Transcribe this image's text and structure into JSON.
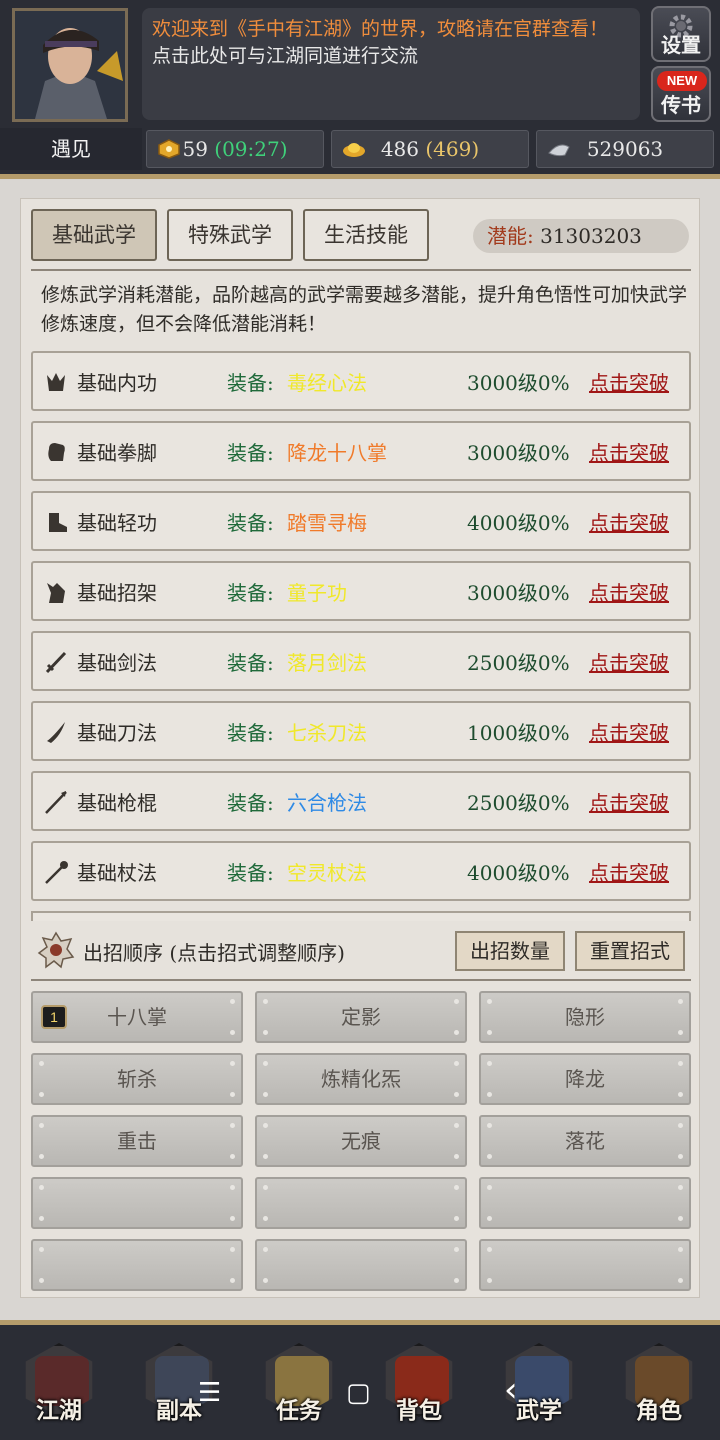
{
  "header": {
    "message_line1": "欢迎来到《手中有江湖》的世界，攻略请在官群查看！",
    "message_line2": "点击此处可与江湖同道进行交流",
    "settings_label": "设置",
    "letter_badge": "NEW",
    "letter_label": "传书",
    "encounter_label": "遇见",
    "resources": [
      {
        "icon": "stamina-icon",
        "value": "59",
        "sub": "(09:27)"
      },
      {
        "icon": "gold-ingot-icon",
        "value": "486",
        "sub": "(469)"
      },
      {
        "icon": "silver-icon",
        "value": "529063",
        "sub": ""
      }
    ]
  },
  "tabs": [
    {
      "label": "基础武学",
      "active": true
    },
    {
      "label": "特殊武学",
      "active": false
    },
    {
      "label": "生活技能",
      "active": false
    }
  ],
  "potential": {
    "label": "潜能:",
    "value": "31303203"
  },
  "description": "修炼武学消耗潜能，品阶越高的武学需要越多潜能，提升角色悟性可加快武学修炼速度，但不会降低潜能消耗！",
  "skills": [
    {
      "name": "基础内功",
      "icon": "inner-power-icon",
      "equip_label": "装备:",
      "equip": "毒经心法",
      "equip_color": "#f0e82a",
      "level": "3000级0%",
      "action": "点击突破"
    },
    {
      "name": "基础拳脚",
      "icon": "fist-icon",
      "equip_label": "装备:",
      "equip": "降龙十八掌",
      "equip_color": "#f07a2a",
      "level": "3000级0%",
      "action": "点击突破"
    },
    {
      "name": "基础轻功",
      "icon": "boot-icon",
      "equip_label": "装备:",
      "equip": "踏雪寻梅",
      "equip_color": "#f07a2a",
      "level": "4000级0%",
      "action": "点击突破"
    },
    {
      "name": "基础招架",
      "icon": "parry-icon",
      "equip_label": "装备:",
      "equip": "童子功",
      "equip_color": "#f0e82a",
      "level": "3000级0%",
      "action": "点击突破"
    },
    {
      "name": "基础剑法",
      "icon": "sword-icon",
      "equip_label": "装备:",
      "equip": "落月剑法",
      "equip_color": "#f0e82a",
      "level": "2500级0%",
      "action": "点击突破"
    },
    {
      "name": "基础刀法",
      "icon": "saber-icon",
      "equip_label": "装备:",
      "equip": "七杀刀法",
      "equip_color": "#f0e82a",
      "level": "1000级0%",
      "action": "点击突破"
    },
    {
      "name": "基础枪棍",
      "icon": "spear-icon",
      "equip_label": "装备:",
      "equip": "六合枪法",
      "equip_color": "#2f8ae5",
      "level": "2500级0%",
      "action": "点击突破"
    },
    {
      "name": "基础杖法",
      "icon": "staff-icon",
      "equip_label": "装备:",
      "equip": "空灵杖法",
      "equip_color": "#f0e82a",
      "level": "4000级0%",
      "action": "点击突破"
    }
  ],
  "order": {
    "title": "出招顺序 (点击招式调整顺序)",
    "count_button": "出招数量",
    "reset_button": "重置招式",
    "first_seal": "1",
    "moves": [
      "十八掌",
      "定影",
      "隐形",
      "斩杀",
      "炼精化炁",
      "降龙",
      "重击",
      "无痕",
      "落花",
      "",
      "",
      "",
      "",
      "",
      ""
    ]
  },
  "nav": [
    {
      "label": "江湖",
      "color": "#5a2a2a"
    },
    {
      "label": "副本",
      "color": "#3e4658"
    },
    {
      "label": "任务",
      "color": "#8a7440"
    },
    {
      "label": "背包",
      "color": "#8a2a1a"
    },
    {
      "label": "武学",
      "color": "#3a4a6a"
    },
    {
      "label": "角色",
      "color": "#6a4a2a"
    }
  ],
  "system_nav": {
    "menu": "☰",
    "home": "▢",
    "back": "‹"
  }
}
